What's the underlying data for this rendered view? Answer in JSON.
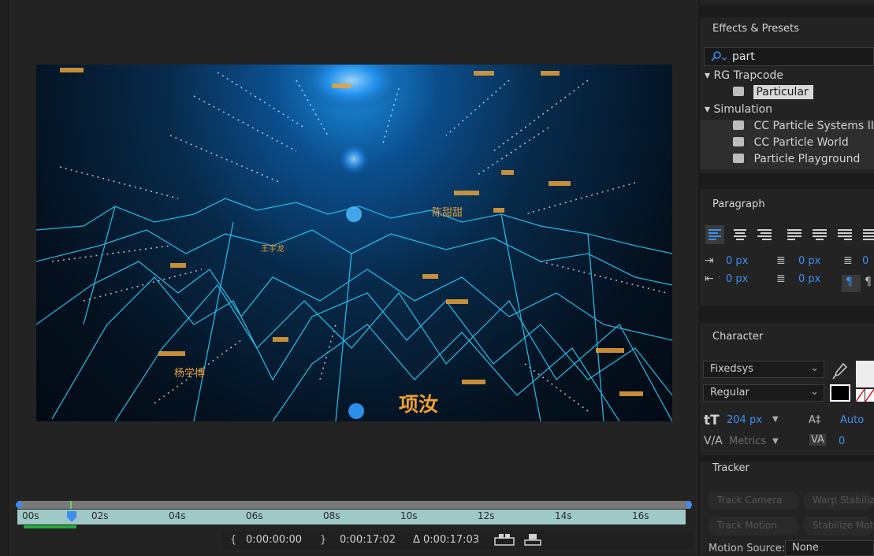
{
  "preview": {
    "names": [
      "王宇龙",
      "陈甜甜",
      "项汝",
      "杨学博"
    ]
  },
  "timeline": {
    "ticks": [
      "00s",
      "02s",
      "04s",
      "06s",
      "08s",
      "10s",
      "12s",
      "14s",
      "16s"
    ],
    "start": "0:00:00:00",
    "end": "0:00:17:02",
    "duration": "Δ 0:00:17:03"
  },
  "effects": {
    "title": "Effects & Presets",
    "search": "part",
    "groups": [
      {
        "name": "RG Trapcode",
        "items": [
          "Particular"
        ]
      },
      {
        "name": "Simulation",
        "items": [
          "CC Particle Systems II",
          "CC Particle World",
          "Particle Playground"
        ]
      }
    ]
  },
  "paragraph": {
    "title": "Paragraph",
    "indent_left": "0 px",
    "indent_first": "0 px",
    "space_before": "0 px",
    "space_after": "0 px",
    "indent_right": "0"
  },
  "character": {
    "title": "Character",
    "font": "Fixedsys",
    "style": "Regular",
    "size": "204 px",
    "leading": "Auto",
    "kerning": "Metrics",
    "tracking": "0"
  },
  "tracker": {
    "title": "Tracker",
    "track_camera": "Track Camera",
    "warp_stabilizer": "Warp Stabilizer",
    "track_motion": "Track Motion",
    "stabilize_motion": "Stabilize Motion",
    "motion_source_label": "Motion Source:",
    "motion_source_value": "None"
  },
  "colors": {
    "accent": "#3d8ff0",
    "ruler": "#9ec9c6",
    "work_area": "#1fae3a",
    "label_orange": "#e8a23a"
  }
}
